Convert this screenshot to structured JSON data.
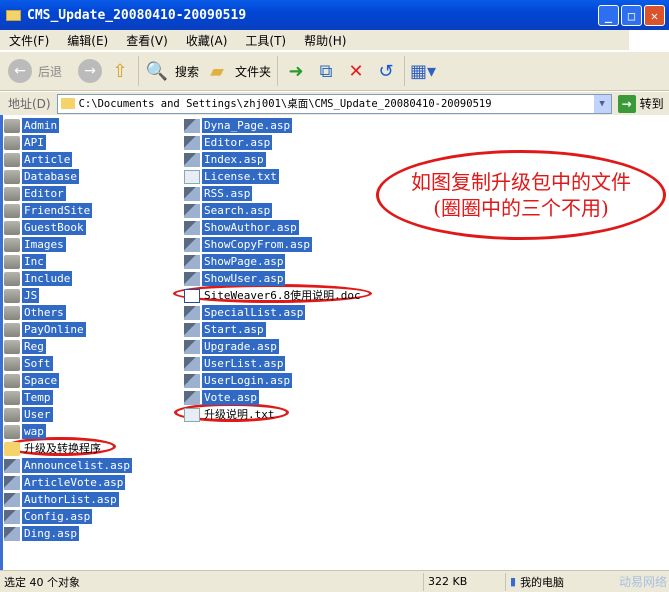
{
  "window": {
    "title": "CMS_Update_20080410-20090519"
  },
  "menu": [
    "文件(F)",
    "编辑(E)",
    "查看(V)",
    "收藏(A)",
    "工具(T)",
    "帮助(H)"
  ],
  "toolbar": {
    "back": "后退",
    "search": "搜索",
    "folders": "文件夹"
  },
  "address": {
    "label": "地址(D)",
    "value": "C:\\Documents and Settings\\zhj001\\桌面\\CMS_Update_20080410-20090519",
    "go": "转到"
  },
  "files": {
    "col1": [
      {
        "name": "Admin",
        "type": "folder"
      },
      {
        "name": "API",
        "type": "folder"
      },
      {
        "name": "Article",
        "type": "folder"
      },
      {
        "name": "Database",
        "type": "folder"
      },
      {
        "name": "Editor",
        "type": "folder"
      },
      {
        "name": "FriendSite",
        "type": "folder"
      },
      {
        "name": "GuestBook",
        "type": "folder"
      },
      {
        "name": "Images",
        "type": "folder"
      },
      {
        "name": "Inc",
        "type": "folder"
      },
      {
        "name": "Include",
        "type": "folder"
      },
      {
        "name": "JS",
        "type": "folder"
      },
      {
        "name": "Others",
        "type": "folder"
      },
      {
        "name": "PayOnline",
        "type": "folder"
      },
      {
        "name": "Reg",
        "type": "folder"
      },
      {
        "name": "Soft",
        "type": "folder"
      },
      {
        "name": "Space",
        "type": "folder"
      },
      {
        "name": "Temp",
        "type": "folder"
      },
      {
        "name": "User",
        "type": "folder"
      },
      {
        "name": "wap",
        "type": "folder"
      },
      {
        "name": "升级及转换程序",
        "type": "folder",
        "selected": false
      },
      {
        "name": "Announcelist.asp",
        "type": "asp"
      },
      {
        "name": "ArticleVote.asp",
        "type": "asp"
      },
      {
        "name": "AuthorList.asp",
        "type": "asp"
      },
      {
        "name": "Config.asp",
        "type": "asp"
      },
      {
        "name": "Ding.asp",
        "type": "asp"
      }
    ],
    "col2": [
      {
        "name": "Dyna_Page.asp",
        "type": "asp"
      },
      {
        "name": "Editor.asp",
        "type": "asp"
      },
      {
        "name": "Index.asp",
        "type": "asp"
      },
      {
        "name": "License.txt",
        "type": "txt"
      },
      {
        "name": "RSS.asp",
        "type": "asp"
      },
      {
        "name": "Search.asp",
        "type": "asp"
      },
      {
        "name": "ShowAuthor.asp",
        "type": "asp"
      },
      {
        "name": "ShowCopyFrom.asp",
        "type": "asp"
      },
      {
        "name": "ShowPage.asp",
        "type": "asp"
      },
      {
        "name": "ShowUser.asp",
        "type": "asp"
      },
      {
        "name": "SiteWeaver6.8使用说明.doc",
        "type": "doc",
        "selected": false
      },
      {
        "name": "SpecialList.asp",
        "type": "asp"
      },
      {
        "name": "Start.asp",
        "type": "asp"
      },
      {
        "name": "Upgrade.asp",
        "type": "asp"
      },
      {
        "name": "UserList.asp",
        "type": "asp"
      },
      {
        "name": "UserLogin.asp",
        "type": "asp"
      },
      {
        "name": "Vote.asp",
        "type": "asp"
      },
      {
        "name": "升级说明.txt",
        "type": "txt",
        "selected": false
      }
    ]
  },
  "annotation": {
    "line1": "如图复制升级包中的文件",
    "line2": "(圈圈中的三个不用)",
    "color": "#e01818"
  },
  "status": {
    "selection": "选定 40 个对象",
    "size": "322 KB",
    "location": "我的电脑",
    "watermark": "动易网络"
  }
}
